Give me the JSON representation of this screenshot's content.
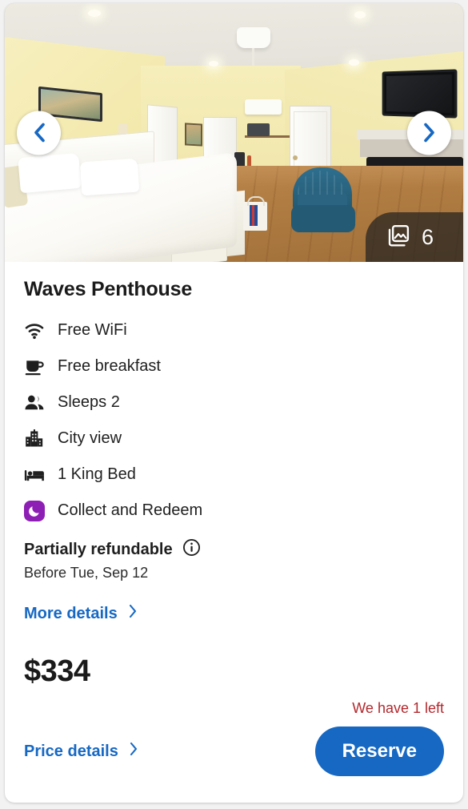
{
  "gallery": {
    "prev_label": "Previous photo",
    "next_label": "Next photo",
    "prev_icon": "chevron-left-icon",
    "next_icon": "chevron-right-icon",
    "photo_count": "6",
    "photo_count_icon": "photo-stack-icon",
    "alt": "Hotel room with king bed, blue armchair and fireplace"
  },
  "room": {
    "title": "Waves Penthouse",
    "amenities": [
      {
        "icon": "wifi-icon",
        "label": "Free WiFi"
      },
      {
        "icon": "coffee-icon",
        "label": "Free breakfast"
      },
      {
        "icon": "people-icon",
        "label": "Sleeps 2"
      },
      {
        "icon": "building-icon",
        "label": "City view"
      },
      {
        "icon": "bed-icon",
        "label": "1 King Bed"
      },
      {
        "icon": "moon-badge-icon",
        "label": "Collect and Redeem"
      }
    ]
  },
  "policy": {
    "title": "Partially refundable",
    "info_icon": "info-icon",
    "deadline": "Before Tue, Sep 12",
    "more_details_label": "More details",
    "more_details_icon": "chevron-right-icon"
  },
  "pricing": {
    "price": "$334",
    "stock_note": "We have 1 left",
    "price_details_label": "Price details",
    "price_details_icon": "chevron-right-icon",
    "reserve_label": "Reserve"
  },
  "colors": {
    "accent_blue": "#1668c3",
    "alert_red": "#b3282d",
    "loyalty_purple": "#8e1fb5",
    "text_dark": "#1a1a1a",
    "page_bg": "#f2f2f2"
  }
}
